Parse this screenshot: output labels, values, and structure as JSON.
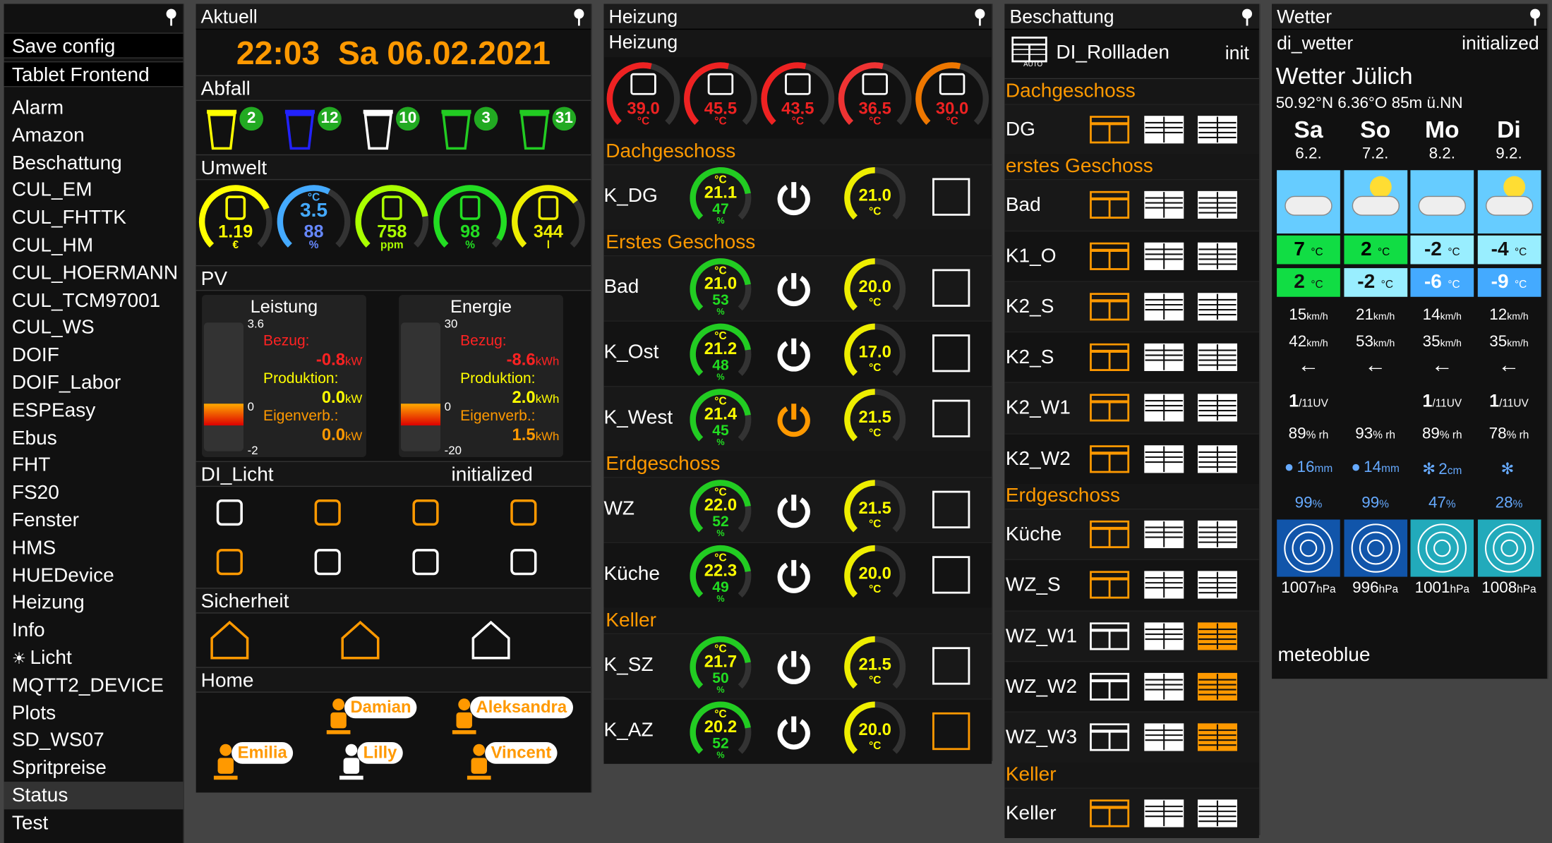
{
  "sidebar": {
    "buttons": [
      "Save config",
      "Tablet Frontend"
    ],
    "items": [
      "Alarm",
      "Amazon",
      "Beschattung",
      "CUL_EM",
      "CUL_FHTTK",
      "CUL_HM",
      "CUL_HOERMANN",
      "CUL_TCM97001",
      "CUL_WS",
      "DOIF",
      "DOIF_Labor",
      "ESPEasy",
      "Ebus",
      "FHT",
      "FS20",
      "Fenster",
      "HMS",
      "HUEDevice",
      "Heizung",
      "Info",
      "Licht",
      "MQTT2_DEVICE",
      "Plots",
      "SD_WS07",
      "Spritpreise",
      "Status",
      "Test"
    ],
    "selected": "Status"
  },
  "aktuell": {
    "title": "Aktuell",
    "time": "22:03",
    "date": "Sa 06.02.2021",
    "abfall": {
      "label": "Abfall",
      "bins": [
        {
          "color": "#ff0",
          "days": "2"
        },
        {
          "color": "#22f",
          "days": "12"
        },
        {
          "color": "#fff",
          "days": "10"
        },
        {
          "color": "#2c2",
          "days": "3"
        },
        {
          "color": "#2c2",
          "days": "31"
        }
      ]
    },
    "umwelt": {
      "label": "Umwelt",
      "gauges": [
        {
          "value": "1.19",
          "unit": "€",
          "color": "#ff0",
          "frac": 0.75
        },
        {
          "value": "3.5",
          "value2": "88",
          "unit": "°C",
          "unit2": "%",
          "color": "#4af",
          "frac": 0.6
        },
        {
          "value": "758",
          "unit": "ppm",
          "color": "#af0",
          "frac": 0.8
        },
        {
          "value": "98",
          "unit": "%",
          "color": "#2d2",
          "frac": 0.95
        },
        {
          "value": "344",
          "unit": "l",
          "color": "#ee0",
          "frac": 0.7
        }
      ]
    },
    "pv": {
      "label": "PV",
      "leistung": {
        "title": "Leistung",
        "max": "3.6",
        "zero": "0",
        "min": "-2",
        "bezug_label": "Bezug:",
        "bezug": "-0.8",
        "bezug_unit": "kW",
        "prod_label": "Produktion:",
        "prod": "0.0",
        "prod_unit": "kW",
        "eigen_label": "Eigenverb.:",
        "eigen": "0.0",
        "eigen_unit": "kW"
      },
      "energie": {
        "title": "Energie",
        "max": "30",
        "zero": "0",
        "min": "-20",
        "bezug_label": "Bezug:",
        "bezug": "-8.6",
        "bezug_unit": "kWh",
        "prod_label": "Produktion:",
        "prod": "2.0",
        "prod_unit": "kWh",
        "eigen_label": "Eigenverb.:",
        "eigen": "1.5",
        "eigen_unit": "kWh"
      }
    },
    "licht": {
      "label": "DI_Licht",
      "state": "initialized"
    },
    "sicherheit": {
      "label": "Sicherheit"
    },
    "home": {
      "label": "Home",
      "persons": [
        "Damian",
        "Aleksandra",
        "Emilia",
        "Lilly",
        "Vincent"
      ]
    }
  },
  "heizung": {
    "title": "Heizung",
    "subtitle": "Heizung",
    "top": [
      {
        "value": "39.0",
        "unit": "°C",
        "color": "#e22"
      },
      {
        "value": "45.5",
        "unit": "°C",
        "color": "#e22"
      },
      {
        "value": "43.5",
        "unit": "°C",
        "color": "#e22"
      },
      {
        "value": "36.5",
        "unit": "°C",
        "color": "#e33"
      },
      {
        "value": "30.0",
        "unit": "°C",
        "color": "#e70"
      }
    ],
    "groups": [
      {
        "name": "Dachgeschoss",
        "rooms": [
          {
            "name": "K_DG",
            "temp": "21.1",
            "hum": "47",
            "set": "21.0",
            "power_on": false,
            "window_open": false
          }
        ]
      },
      {
        "name": "Erstes Geschoss",
        "rooms": [
          {
            "name": "Bad",
            "temp": "21.0",
            "hum": "53",
            "set": "20.0",
            "power_on": false,
            "window_open": false
          },
          {
            "name": "K_Ost",
            "temp": "21.2",
            "hum": "48",
            "set": "17.0",
            "power_on": false,
            "window_open": false
          },
          {
            "name": "K_West",
            "temp": "21.4",
            "hum": "45",
            "set": "21.5",
            "power_on": true,
            "window_open": false
          }
        ]
      },
      {
        "name": "Erdgeschoss",
        "rooms": [
          {
            "name": "WZ",
            "temp": "22.0",
            "hum": "52",
            "set": "21.5",
            "power_on": false,
            "window_open": false
          },
          {
            "name": "Küche",
            "temp": "22.3",
            "hum": "49",
            "set": "20.0",
            "power_on": false,
            "window_open": false
          }
        ]
      },
      {
        "name": "Keller",
        "rooms": [
          {
            "name": "K_SZ",
            "temp": "21.7",
            "hum": "50",
            "set": "21.5",
            "power_on": false,
            "window_open": false
          },
          {
            "name": "K_AZ",
            "temp": "20.2",
            "hum": "52",
            "set": "20.0",
            "power_on": false,
            "window_open": true
          }
        ]
      }
    ],
    "unit_c": "°C",
    "unit_pct": "%"
  },
  "beschattung": {
    "title": "Beschattung",
    "device": "DI_Rollladen",
    "device_badge": "AUTO",
    "state": "init",
    "groups": [
      {
        "name": "Dachgeschoss",
        "rows": [
          {
            "name": "DG",
            "active": 0
          }
        ]
      },
      {
        "name": "erstes Geschoss",
        "rows": [
          {
            "name": "Bad",
            "active": 0
          },
          {
            "name": "K1_O",
            "active": 0
          },
          {
            "name": "K2_S",
            "active": 0
          },
          {
            "name": "K2_S",
            "active": 0
          },
          {
            "name": "K2_W1",
            "active": 0
          },
          {
            "name": "K2_W2",
            "active": 0
          }
        ]
      },
      {
        "name": "Erdgeschoss",
        "rows": [
          {
            "name": "Küche",
            "active": 0
          },
          {
            "name": "WZ_S",
            "active": 0
          },
          {
            "name": "WZ_W1",
            "active": 2
          },
          {
            "name": "WZ_W2",
            "active": 2
          },
          {
            "name": "WZ_W3",
            "active": 2
          }
        ]
      },
      {
        "name": "Keller",
        "rows": [
          {
            "name": "Keller",
            "active": 0
          }
        ]
      }
    ]
  },
  "wetter": {
    "title": "Wetter",
    "device": "di_wetter",
    "state": "initialized",
    "location": "Wetter Jülich",
    "coords": "50.92°N 6.36°O 85m ü.NN",
    "days": [
      {
        "day": "Sa",
        "date": "6.2.",
        "max": "7",
        "min": "2",
        "maxc": "#1d4",
        "minc": "#1d4",
        "wind": "15",
        "gust": "42",
        "uv": "1",
        "uvu": "/11UV",
        "rh": "89",
        "precip": "16",
        "punit": "mm",
        "prob": "99",
        "hpa": "1007",
        "iconkind": "rain"
      },
      {
        "day": "So",
        "date": "7.2.",
        "max": "2",
        "min": "-2",
        "maxc": "#1d4",
        "minc": "#9ef",
        "wind": "21",
        "gust": "53",
        "uv": "",
        "uvu": "",
        "rh": "93",
        "precip": "14",
        "punit": "mm",
        "prob": "99",
        "hpa": "996",
        "iconkind": "sunrain"
      },
      {
        "day": "Mo",
        "date": "8.2.",
        "max": "-2",
        "min": "-6",
        "maxc": "#9ef",
        "minc": "#4af",
        "wind": "14",
        "gust": "35",
        "uv": "1",
        "uvu": "/11UV",
        "rh": "89",
        "precip": "2",
        "punit": "cm",
        "prob": "47",
        "hpa": "1001",
        "iconkind": "snow"
      },
      {
        "day": "Di",
        "date": "9.2.",
        "max": "-4",
        "min": "-9",
        "maxc": "#9ef",
        "minc": "#4af",
        "wind": "12",
        "gust": "35",
        "uv": "1",
        "uvu": "/11UV",
        "rh": "78",
        "precip": "",
        "punit": "",
        "prob": "28",
        "hpa": "1008",
        "iconkind": "sun"
      }
    ],
    "units": {
      "c": "°C",
      "wind": "km/h",
      "rh": "% rh",
      "pct": "%",
      "hpa": "hPa"
    },
    "footer": "meteoblue"
  }
}
